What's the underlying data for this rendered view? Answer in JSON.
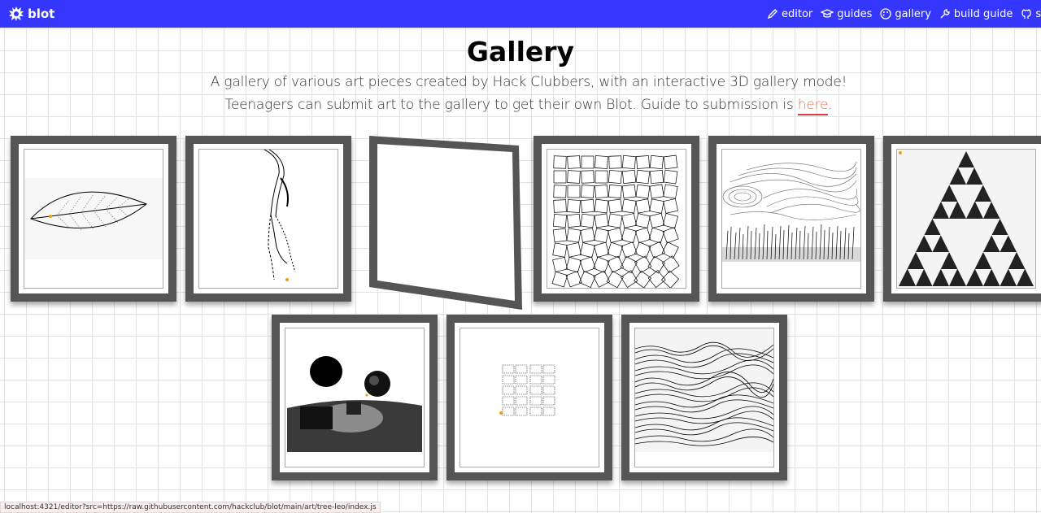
{
  "navbar": {
    "brand": "blot",
    "links": [
      "editor",
      "guides",
      "gallery",
      "build guide",
      "source"
    ],
    "color": "#3537ff"
  },
  "header": {
    "title": "Gallery",
    "line1": "A gallery of various art pieces created by Hack Clubbers, with an interactive 3D gallery mode!",
    "line2_prefix": "Teenagers can submit art to the gallery to get their own Blot. Guide to submission is ",
    "line2_link": "here",
    "line2_suffix": "."
  },
  "gallery": {
    "items": [
      "leaf",
      "tree",
      "blank-tilted",
      "square-grid",
      "wind-field",
      "sierpinski",
      "spheres-3d",
      "text-maze",
      "wave-lines"
    ]
  },
  "status_bar": {
    "url": "localhost:4321/editor?src=https://raw.githubusercontent.com/hackclub/blot/main/art/tree-leo/index.js"
  }
}
